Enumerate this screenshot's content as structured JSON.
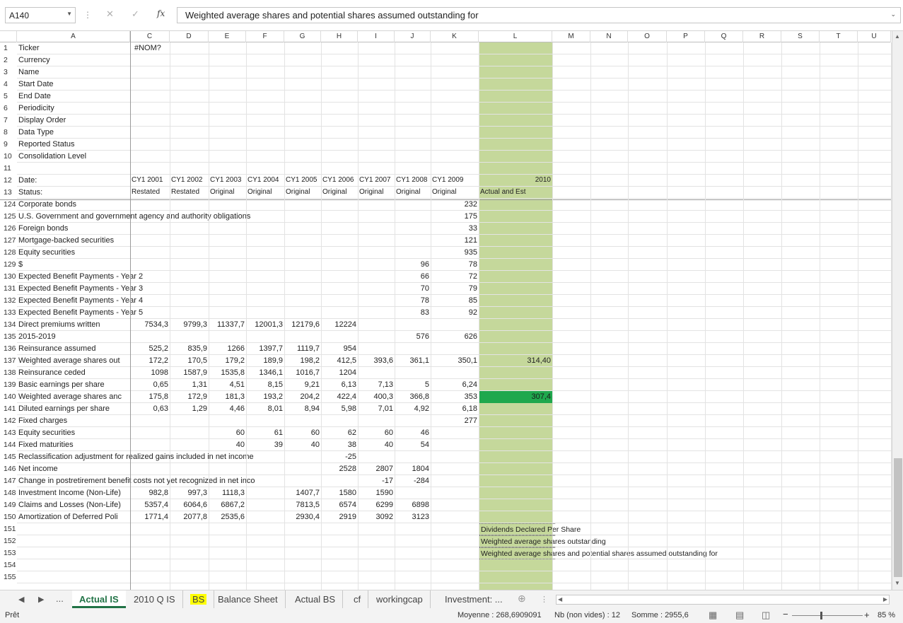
{
  "formula_bar": {
    "name_box": "A140",
    "formula": "Weighted average shares and potential shares assumed outstanding for",
    "fx": "fx"
  },
  "columns": [
    "A",
    "C",
    "D",
    "E",
    "F",
    "G",
    "H",
    "I",
    "J",
    "K",
    "L",
    "M",
    "N",
    "O",
    "P",
    "Q",
    "R",
    "S",
    "T",
    "U"
  ],
  "rows": [
    {
      "n": "1",
      "label": "Ticker",
      "C": "#NOM?"
    },
    {
      "n": "2",
      "label": "Currency"
    },
    {
      "n": "3",
      "label": "Name"
    },
    {
      "n": "4",
      "label": "Start Date"
    },
    {
      "n": "5",
      "label": "End Date"
    },
    {
      "n": "6",
      "label": "Periodicity"
    },
    {
      "n": "7",
      "label": "Display Order"
    },
    {
      "n": "8",
      "label": "Data Type"
    },
    {
      "n": "9",
      "label": "Reported Status"
    },
    {
      "n": "10",
      "label": "Consolidation Level"
    },
    {
      "n": "11",
      "label": ""
    },
    {
      "n": "12",
      "label": "Date:",
      "C": "CY1 2001",
      "D": "CY1 2002",
      "E": "CY1 2003",
      "F": "CY1 2004",
      "G": "CY1 2005",
      "H": "CY1 2006",
      "I": "CY1 2007",
      "J": "CY1 2008",
      "K": "CY1 2009",
      "L": "2010"
    },
    {
      "n": "13",
      "label": "Status:",
      "C": "Restated",
      "D": "Restated",
      "E": "Original",
      "F": "Original",
      "G": "Original",
      "H": "Original",
      "I": "Original",
      "J": "Original",
      "K": "Original",
      "L": "Actual and Est"
    },
    {
      "n": "124",
      "label": "Corporate bonds",
      "K": "232"
    },
    {
      "n": "125",
      "label": "U.S. Government and government agency and authority obligations",
      "K": "175"
    },
    {
      "n": "126",
      "label": "Foreign bonds",
      "K": "33"
    },
    {
      "n": "127",
      "label": "Mortgage-backed securities",
      "K": "121"
    },
    {
      "n": "128",
      "label": "Equity securities",
      "K": "935"
    },
    {
      "n": "129",
      "label": "$",
      "J": "96",
      "K": "78"
    },
    {
      "n": "130",
      "label": "Expected Benefit Payments - Year 2",
      "J": "66",
      "K": "72"
    },
    {
      "n": "131",
      "label": "Expected Benefit Payments - Year 3",
      "J": "70",
      "K": "79"
    },
    {
      "n": "132",
      "label": "Expected Benefit Payments - Year 4",
      "J": "78",
      "K": "85"
    },
    {
      "n": "133",
      "label": "Expected Benefit Payments - Year 5",
      "J": "83",
      "K": "92"
    },
    {
      "n": "134",
      "label": "Direct premiums written",
      "C": "7534,3",
      "D": "9799,3",
      "E": "11337,7",
      "F": "12001,3",
      "G": "12179,6",
      "H": "12224"
    },
    {
      "n": "135",
      "label": "2015-2019",
      "J": "576",
      "K": "626"
    },
    {
      "n": "136",
      "label": "Reinsurance assumed",
      "C": "525,2",
      "D": "835,9",
      "E": "1266",
      "F": "1397,7",
      "G": "1119,7",
      "H": "954"
    },
    {
      "n": "137",
      "label": "Weighted average shares out",
      "C": "172,2",
      "D": "170,5",
      "E": "179,2",
      "F": "189,9",
      "G": "198,2",
      "H": "412,5",
      "I": "393,6",
      "J": "361,1",
      "K": "350,1",
      "L": "314,40"
    },
    {
      "n": "138",
      "label": "Reinsurance ceded",
      "C": "1098",
      "D": "1587,9",
      "E": "1535,8",
      "F": "1346,1",
      "G": "1016,7",
      "H": "1204"
    },
    {
      "n": "139",
      "label": "Basic earnings per share",
      "C": "0,65",
      "D": "1,31",
      "E": "4,51",
      "F": "8,15",
      "G": "9,21",
      "H": "6,13",
      "I": "7,13",
      "J": "5",
      "K": "6,24"
    },
    {
      "n": "140",
      "label": "Weighted average shares anc",
      "C": "175,8",
      "D": "172,9",
      "E": "181,3",
      "F": "193,2",
      "G": "204,2",
      "H": "422,4",
      "I": "400,3",
      "J": "366,8",
      "K": "353",
      "L": "307,4"
    },
    {
      "n": "141",
      "label": "Diluted earnings per share",
      "C": "0,63",
      "D": "1,29",
      "E": "4,46",
      "F": "8,01",
      "G": "8,94",
      "H": "5,98",
      "I": "7,01",
      "J": "4,92",
      "K": "6,18"
    },
    {
      "n": "142",
      "label": "Fixed charges",
      "K": "277"
    },
    {
      "n": "143",
      "label": "Equity securities",
      "E": "60",
      "F": "61",
      "G": "60",
      "H": "62",
      "I": "60",
      "J": "46"
    },
    {
      "n": "144",
      "label": "Fixed maturities",
      "E": "40",
      "F": "39",
      "G": "40",
      "H": "38",
      "I": "40",
      "J": "54"
    },
    {
      "n": "145",
      "label": "Reclassification adjustment for realized gains included in net income",
      "H": "-25"
    },
    {
      "n": "146",
      "label": "Net income",
      "H": "2528",
      "I": "2807",
      "J": "1804"
    },
    {
      "n": "147",
      "label": "Change in postretirement benefit costs not yet recognized in net inco",
      "I": "-17",
      "J": "-284"
    },
    {
      "n": "148",
      "label": "Investment Income (Non-Life)",
      "C": "982,8",
      "D": "997,3",
      "E": "1118,3",
      "G": "1407,7",
      "H": "1580",
      "I": "1590"
    },
    {
      "n": "149",
      "label": "Claims and Losses (Non-Life)",
      "C": "5357,4",
      "D": "6064,6",
      "E": "6867,2",
      "G": "7813,5",
      "H": "6574",
      "I": "6299",
      "J": "6898"
    },
    {
      "n": "150",
      "label": "Amortization of Deferred Poli",
      "C": "1771,4",
      "D": "2077,8",
      "E": "2535,6",
      "G": "2930,4",
      "H": "2919",
      "I": "3092",
      "J": "3123"
    },
    {
      "n": "151",
      "label": "",
      "L": "Dividends Declared Per Share"
    },
    {
      "n": "152",
      "label": "",
      "L": "Weighted average shares outstanding"
    },
    {
      "n": "153",
      "label": "",
      "L": "Weighted average shares and potential shares assumed outstanding for"
    },
    {
      "n": "154",
      "label": ""
    },
    {
      "n": "155",
      "label": ""
    }
  ],
  "tabs": {
    "more": "...",
    "items": [
      {
        "label": "Actual IS",
        "active": true
      },
      {
        "label": "2010 Q IS"
      },
      {
        "label": "BS",
        "highlight": true
      },
      {
        "label": "Balance Sheet"
      },
      {
        "label": "Actual BS"
      },
      {
        "label": "cf"
      },
      {
        "label": "workingcap"
      },
      {
        "label": "Investment: ..."
      }
    ]
  },
  "status_bar": {
    "ready": "Prêt",
    "average": "Moyenne : 268,6909091",
    "count": "Nb (non vides) : 12",
    "sum": "Somme : 2955,6",
    "zoom": "85 %"
  },
  "colors": {
    "green_band": "#c5d89b",
    "selected_green": "#1fa84d",
    "excel_green": "#217346",
    "tab_yellow": "#ffff00"
  }
}
